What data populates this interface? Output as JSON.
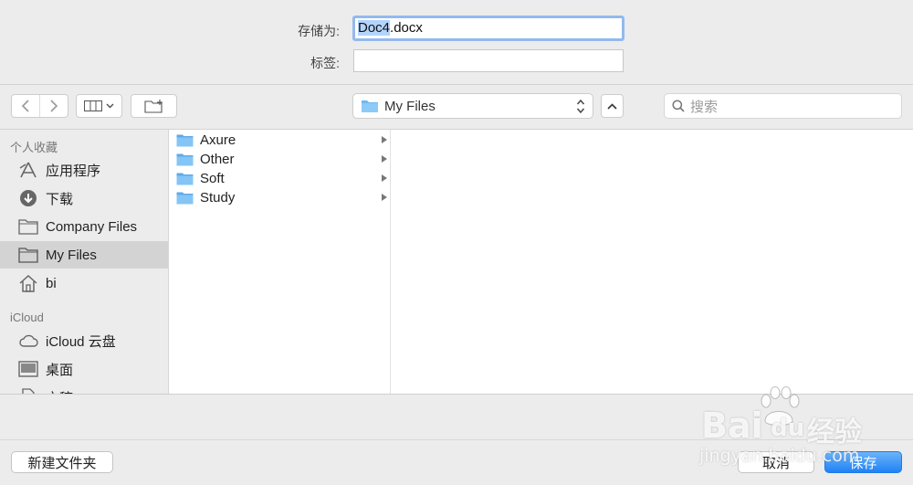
{
  "form": {
    "save_as_label": "存储为:",
    "filename_selected": "Doc4",
    "filename_ext": ".docx",
    "tags_label": "标签:",
    "tags_value": ""
  },
  "toolbar": {
    "location": "My Files",
    "search_placeholder": "搜索"
  },
  "sidebar": {
    "favorites_title": "个人收藏",
    "favorites": [
      {
        "label": "应用程序",
        "icon": "applications-icon"
      },
      {
        "label": "下载",
        "icon": "downloads-icon"
      },
      {
        "label": "Company Files",
        "icon": "folder-icon"
      },
      {
        "label": "My Files",
        "icon": "folder-icon",
        "active": true
      },
      {
        "label": "bi",
        "icon": "home-icon"
      }
    ],
    "icloud_title": "iCloud",
    "icloud": [
      {
        "label": "iCloud 云盘",
        "icon": "cloud-icon"
      },
      {
        "label": "桌面",
        "icon": "desktop-icon"
      },
      {
        "label": "文稿",
        "icon": "documents-icon"
      }
    ]
  },
  "browser": {
    "folders": [
      "Axure",
      "Other",
      "Soft",
      "Study"
    ]
  },
  "buttons": {
    "new_folder": "新建文件夹",
    "cancel": "取消",
    "save": "保存"
  },
  "watermark": {
    "brand_latin": "Bai",
    "brand_du": "du",
    "brand_cn": "经验",
    "url": "jingyan.baidu.com"
  },
  "colors": {
    "accent": "#1f83f5",
    "selection": "#b3d4fc",
    "folder": "#6fb8f0"
  }
}
